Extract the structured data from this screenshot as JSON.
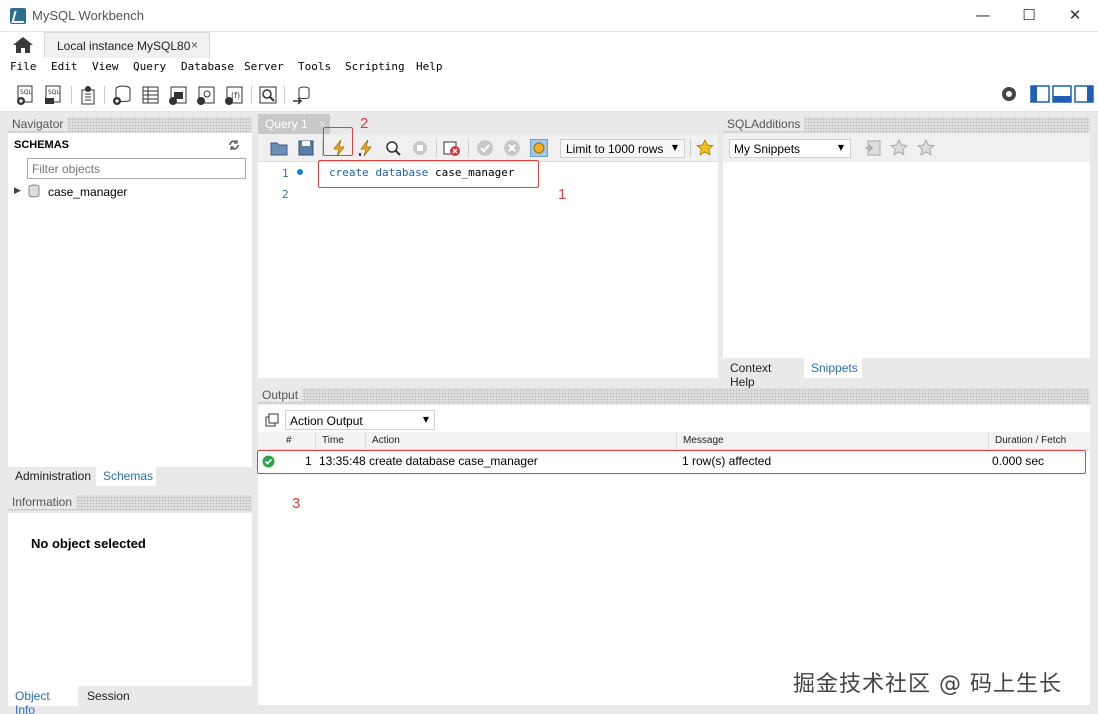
{
  "window": {
    "title": "MySQL Workbench",
    "minimize": "—",
    "maximize": "☐",
    "close": "✕"
  },
  "tabs": {
    "connection": "Local instance MySQL80",
    "close": "×"
  },
  "menu": [
    "File",
    "Edit",
    "View",
    "Query",
    "Database",
    "Server",
    "Tools",
    "Scripting",
    "Help"
  ],
  "navigator": {
    "header": "Navigator",
    "schemas_title": "SCHEMAS",
    "filter_placeholder": "Filter objects",
    "schema_item": "case_manager",
    "bottom_tabs": [
      "Administration",
      "Schemas"
    ]
  },
  "information": {
    "header": "Information",
    "message": "No object selected",
    "bottom_tabs": [
      "Object Info",
      "Session"
    ]
  },
  "editor": {
    "tab_label": "Query 1",
    "tab_close": "×",
    "limit_label": "Limit to 1000 rows",
    "line_numbers": [
      "1",
      "2"
    ],
    "code_kw1": "create",
    "code_kw2": "database",
    "code_ident": "case_manager"
  },
  "sql_additions": {
    "header": "SQLAdditions",
    "snippets_dropdown": "My Snippets",
    "bottom_tabs": [
      "Context Help",
      "Snippets"
    ]
  },
  "output": {
    "header": "Output",
    "dropdown": "Action Output",
    "columns": [
      "#",
      "Time",
      "Action",
      "Message",
      "Duration / Fetch"
    ],
    "rows": [
      {
        "num": "1",
        "time": "13:35:48",
        "action": "create database case_manager",
        "message": "1 row(s) affected",
        "duration": "0.000 sec",
        "status": "success"
      }
    ]
  },
  "annotations": [
    "1",
    "2",
    "3"
  ],
  "watermark": "掘金技术社区 @ 码上生长",
  "colors": {
    "accent_blue": "#2a6fb5",
    "annotation_red": "#e04040",
    "success_green": "#2ea44f",
    "panel_bg": "#e9e9e9"
  }
}
